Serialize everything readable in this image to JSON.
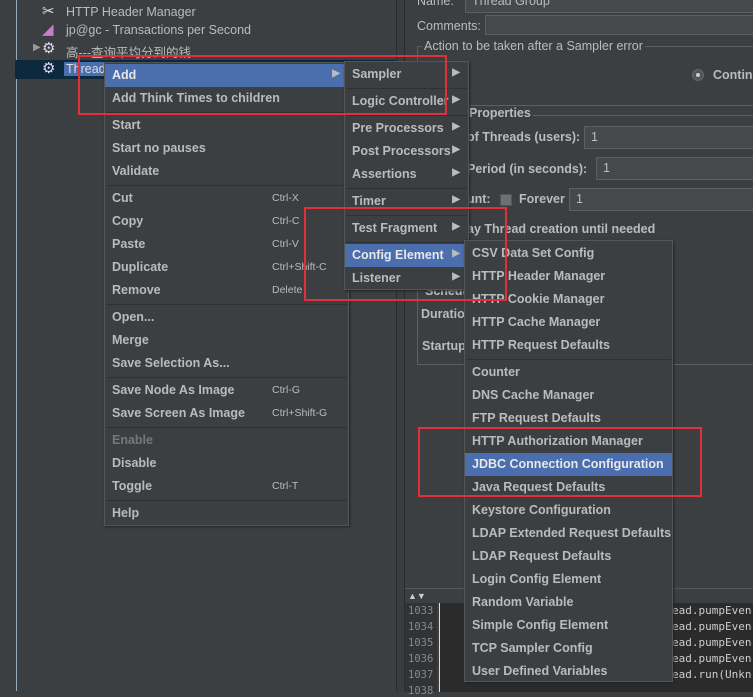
{
  "tree": {
    "items": [
      {
        "label": "HTTP Header Manager",
        "icon": "tools-icon"
      },
      {
        "label": "jp@gc - Transactions per Second",
        "icon": "graph-icon"
      },
      {
        "label": "高---查询平均分到的钱",
        "icon": "gear-icon",
        "expandable": true
      },
      {
        "label": "Thread",
        "icon": "gear-icon",
        "selected": true
      }
    ]
  },
  "context_menu": {
    "groups": [
      [
        {
          "label": "Add",
          "submenu": true,
          "highlighted": true
        },
        {
          "label": "Add Think Times to children"
        }
      ],
      [
        {
          "label": "Start"
        },
        {
          "label": "Start no pauses"
        },
        {
          "label": "Validate"
        }
      ],
      [
        {
          "label": "Cut",
          "shortcut": "Ctrl-X"
        },
        {
          "label": "Copy",
          "shortcut": "Ctrl-C"
        },
        {
          "label": "Paste",
          "shortcut": "Ctrl-V"
        },
        {
          "label": "Duplicate",
          "shortcut": "Ctrl+Shift-C"
        },
        {
          "label": "Remove",
          "shortcut": "Delete"
        }
      ],
      [
        {
          "label": "Open..."
        },
        {
          "label": "Merge"
        },
        {
          "label": "Save Selection As..."
        }
      ],
      [
        {
          "label": "Save Node As Image",
          "shortcut": "Ctrl-G"
        },
        {
          "label": "Save Screen As Image",
          "shortcut": "Ctrl+Shift-G"
        }
      ],
      [
        {
          "label": "Enable",
          "disabled": true
        },
        {
          "label": "Disable"
        },
        {
          "label": "Toggle",
          "shortcut": "Ctrl-T"
        }
      ],
      [
        {
          "label": "Help"
        }
      ]
    ]
  },
  "add_submenu": {
    "groups": [
      [
        {
          "label": "Sampler"
        }
      ],
      [
        {
          "label": "Logic Controller"
        }
      ],
      [
        {
          "label": "Pre Processors"
        },
        {
          "label": "Post Processors"
        },
        {
          "label": "Assertions"
        }
      ],
      [
        {
          "label": "Timer"
        }
      ],
      [
        {
          "label": "Test Fragment"
        }
      ],
      [
        {
          "label": "Config Element",
          "highlighted": true
        },
        {
          "label": "Listener"
        }
      ]
    ]
  },
  "config_submenu": {
    "groups": [
      [
        "CSV Data Set Config",
        "HTTP Header Manager",
        "HTTP Cookie Manager",
        "HTTP Cache Manager",
        "HTTP Request Defaults"
      ],
      [
        "Counter",
        "DNS Cache Manager",
        "FTP Request Defaults",
        "HTTP Authorization Manager",
        "JDBC Connection Configuration",
        "Java Request Defaults",
        "Keystore Configuration",
        "LDAP Extended Request Defaults",
        "LDAP Request Defaults",
        "Login Config Element",
        "Random Variable",
        "Simple Config Element",
        "TCP Sampler Config",
        "User Defined Variables"
      ]
    ],
    "highlighted": "JDBC Connection Configuration"
  },
  "panel": {
    "name_label": "Name:",
    "name_value": "Thread Group",
    "comments_label": "Comments:",
    "sampler_error_title": "Action to be taken after a Sampler error",
    "continue_radio": "Continu",
    "properties_title": "Properties",
    "threads_label": "of Threads (users):",
    "threads_value": "1",
    "ramp_label": "Period (in seconds):",
    "ramp_value": "1",
    "loop_label": "unt:",
    "forever_label": "Forever",
    "loop_value": "1",
    "delay_label": "ay Thread creation until needed",
    "scheduler_label": "Schedu",
    "duration_label": "Duratio",
    "startup_label": "Startup"
  },
  "log": {
    "lines": [
      {
        "num": "1033",
        "text": "ead.pumpEven"
      },
      {
        "num": "1034",
        "text": "ead.pumpEven"
      },
      {
        "num": "1035",
        "text": "ead.pumpEven"
      },
      {
        "num": "1036",
        "text": "ead.pumpEven"
      },
      {
        "num": "1037",
        "text": "ead.run(Unkn"
      },
      {
        "num": "1038",
        "text": ""
      }
    ]
  },
  "colors": {
    "highlight": "#4b6eaf",
    "annotation_red": "#e0303a",
    "background": "#3c3f41"
  }
}
